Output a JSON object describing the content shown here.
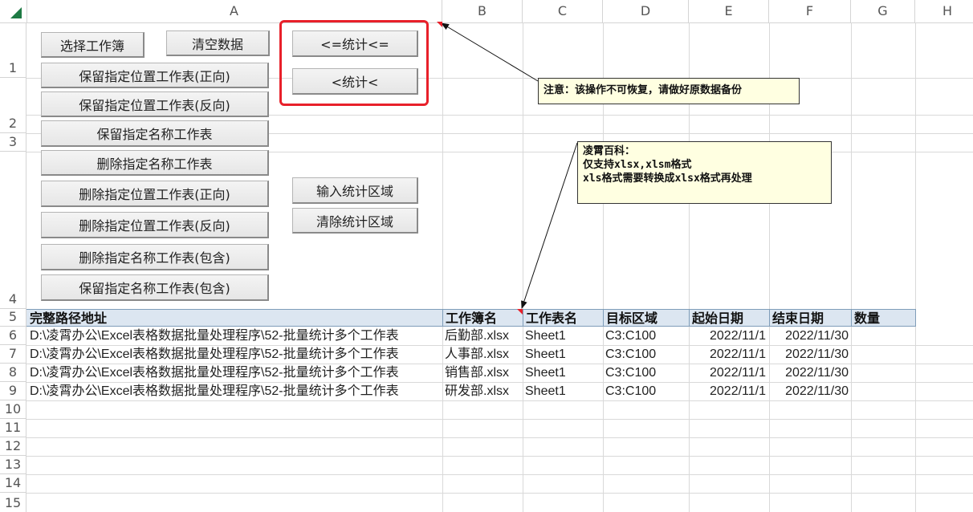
{
  "columns": [
    "A",
    "B",
    "C",
    "D",
    "E",
    "F",
    "G",
    "H"
  ],
  "rows": [
    "1",
    "2",
    "3",
    "4",
    "5",
    "6",
    "7",
    "8",
    "9",
    "10",
    "11",
    "12",
    "13",
    "14",
    "15"
  ],
  "buttons_left": [
    "选择工作簿",
    "清空数据",
    "保留指定位置工作表(正向)",
    "保留指定位置工作表(反向)",
    "保留指定名称工作表",
    "删除指定名称工作表",
    "删除指定位置工作表(正向)",
    "删除指定位置工作表(反向)",
    "删除指定名称工作表(包含)",
    "保留指定名称工作表(包含)"
  ],
  "buttons_stats": [
    "<=统计<=",
    "<统计<",
    "输入统计区域",
    "清除统计区域"
  ],
  "comments": {
    "warning": "注意：该操作不可恢复，请做好原数据备份",
    "info": [
      "凌霄百科：",
      "仅支持xlsx,xlsm格式",
      "xls格式需要转换成xlsx格式再处理"
    ]
  },
  "table": {
    "headers": [
      "完整路径地址",
      "工作簿名",
      "工作表名",
      "目标区域",
      "起始日期",
      "结束日期",
      "数量"
    ],
    "rows": [
      [
        "D:\\凌霄办公\\Excel表格数据批量处理程序\\52-批量统计多个工作表",
        "后勤部.xlsx",
        "Sheet1",
        "C3:C100",
        "2022/11/1",
        "2022/11/30",
        ""
      ],
      [
        "D:\\凌霄办公\\Excel表格数据批量处理程序\\52-批量统计多个工作表",
        "人事部.xlsx",
        "Sheet1",
        "C3:C100",
        "2022/11/1",
        "2022/11/30",
        ""
      ],
      [
        "D:\\凌霄办公\\Excel表格数据批量处理程序\\52-批量统计多个工作表",
        "销售部.xlsx",
        "Sheet1",
        "C3:C100",
        "2022/11/1",
        "2022/11/30",
        ""
      ],
      [
        "D:\\凌霄办公\\Excel表格数据批量处理程序\\52-批量统计多个工作表",
        "研发部.xlsx",
        "Sheet1",
        "C3:C100",
        "2022/11/1",
        "2022/11/30",
        ""
      ]
    ]
  },
  "colors": {
    "header_fill": "#dce6f1",
    "highlight_red": "#e8202a",
    "comment_fill": "#ffffe1",
    "accent_green": "#1e7a44"
  }
}
